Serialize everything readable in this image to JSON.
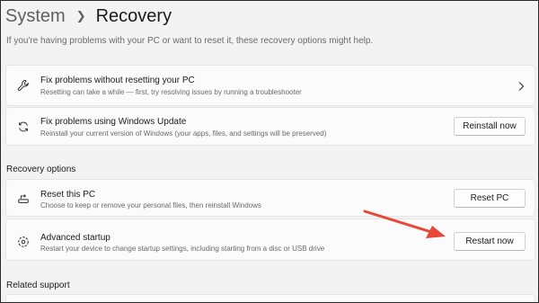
{
  "breadcrumb": {
    "parent": "System",
    "current": "Recovery"
  },
  "intro": "If you're having problems with your PC or want to reset it, these recovery options might help.",
  "top_cards": [
    {
      "icon": "wrench-icon",
      "title": "Fix problems without resetting your PC",
      "description": "Resetting can take a while — first, try resolving issues by running a troubleshooter"
    },
    {
      "icon": "refresh-icon",
      "title": "Fix problems using Windows Update",
      "description": "Reinstall your current version of Windows (your apps, files, and settings will be preserved)",
      "button": "Reinstall now"
    }
  ],
  "recovery_options": {
    "heading": "Recovery options",
    "items": [
      {
        "icon": "reset-pc-icon",
        "title": "Reset this PC",
        "description": "Choose to keep or remove your personal files, then reinstall Windows",
        "button": "Reset PC"
      },
      {
        "icon": "advanced-startup-icon",
        "title": "Advanced startup",
        "description": "Restart your device to change startup settings, including starting from a disc or USB drive",
        "button": "Restart now"
      }
    ]
  },
  "related_support": {
    "heading": "Related support"
  },
  "colors": {
    "annotation_arrow": "#e8473a",
    "card_bg": "#fbfbfb",
    "page_bg": "#f3f3f3"
  }
}
